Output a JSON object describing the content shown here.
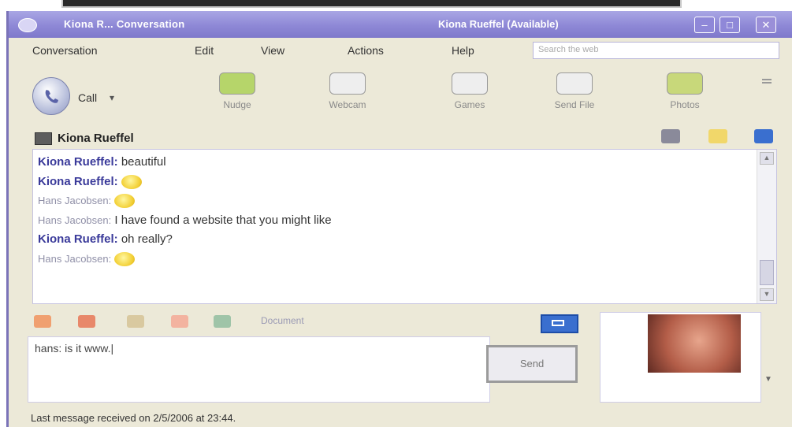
{
  "window": {
    "title": "Kiona R... Conversation",
    "status": "Kiona Rueffel (Available)"
  },
  "menu": [
    "Conversation",
    "Edit",
    "View",
    "Actions",
    "Help"
  ],
  "search": {
    "placeholder": "Search the web"
  },
  "toolbar": {
    "call_label": "Call",
    "call_arrow": "▾",
    "tools": [
      {
        "label": "Nudge",
        "icon": "nudge-icon",
        "color": "#b6d56a"
      },
      {
        "label": "Webcam",
        "icon": "webcam-icon",
        "color": "#eeeeee"
      },
      {
        "label": "Games",
        "icon": "games-icon",
        "color": "#eeeeee"
      },
      {
        "label": "Send File",
        "icon": "send-file-icon",
        "color": "#eeeeee"
      },
      {
        "label": "Photos",
        "icon": "photos-icon",
        "color": "#c8d87a"
      }
    ]
  },
  "contact": {
    "name": "Kiona Rueffel"
  },
  "conversation": {
    "messages": [
      {
        "sender": "Kiona Rueffel:",
        "text": "beautiful",
        "smiley": false,
        "kind": "contact"
      },
      {
        "sender": "Kiona Rueffel:",
        "text": "",
        "smiley": true,
        "kind": "contact"
      },
      {
        "sender": "Hans Jacobsen:",
        "text": "",
        "smiley": true,
        "kind": "self"
      },
      {
        "sender": "Hans Jacobsen:",
        "text": "I have found a website that you might like",
        "smiley": false,
        "kind": "self"
      },
      {
        "sender": "Kiona Rueffel:",
        "text": "oh really?",
        "smiley": false,
        "kind": "contact"
      },
      {
        "sender": "Hans Jacobsen:",
        "text": "",
        "smiley": true,
        "kind": "self"
      }
    ]
  },
  "format": {
    "document_label": "Document"
  },
  "input": {
    "text": "hans: is it www.|"
  },
  "send": {
    "label": "Send"
  },
  "statusbar": {
    "text": "Last message received on 2/5/2006 at 23:44."
  },
  "colors": {
    "titlebar": "#8e88d6",
    "contact_name": "#3a3a9a",
    "self_name": "#9090a8"
  }
}
